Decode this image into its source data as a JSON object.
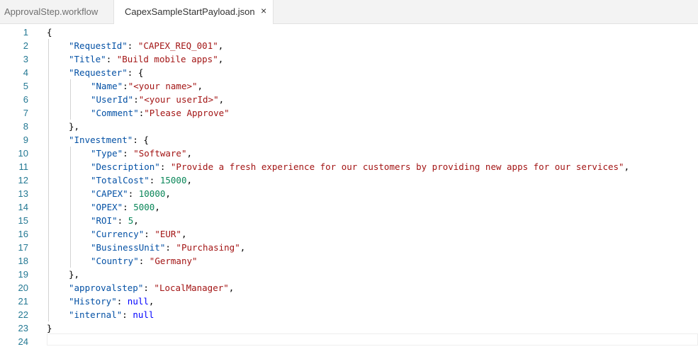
{
  "tabs": [
    {
      "label": "ApprovalStep.workflow",
      "active": false
    },
    {
      "label": "CapexSampleStartPayload.json",
      "active": true,
      "close_glyph": "×"
    }
  ],
  "colors": {
    "key": "#0451a5",
    "string": "#a31515",
    "number": "#098658",
    "literal": "#0000ff",
    "line_number": "#237893"
  },
  "lines": [
    {
      "n": "1",
      "indent": 0,
      "tokens": [
        {
          "t": "{",
          "c": "p"
        }
      ]
    },
    {
      "n": "2",
      "indent": 1,
      "tokens": [
        {
          "t": "\"RequestId\"",
          "c": "key"
        },
        {
          "t": ": ",
          "c": "p"
        },
        {
          "t": "\"CAPEX_REQ_001\"",
          "c": "str"
        },
        {
          "t": ",",
          "c": "p"
        }
      ]
    },
    {
      "n": "3",
      "indent": 1,
      "tokens": [
        {
          "t": "\"Title\"",
          "c": "key"
        },
        {
          "t": ": ",
          "c": "p"
        },
        {
          "t": "\"Build mobile apps\"",
          "c": "str"
        },
        {
          "t": ",",
          "c": "p"
        }
      ]
    },
    {
      "n": "4",
      "indent": 1,
      "tokens": [
        {
          "t": "\"Requester\"",
          "c": "key"
        },
        {
          "t": ": {",
          "c": "p"
        }
      ]
    },
    {
      "n": "5",
      "indent": 2,
      "tokens": [
        {
          "t": "\"Name\"",
          "c": "key"
        },
        {
          "t": ":",
          "c": "p"
        },
        {
          "t": "\"<your name>\"",
          "c": "str"
        },
        {
          "t": ",",
          "c": "p"
        }
      ]
    },
    {
      "n": "6",
      "indent": 2,
      "tokens": [
        {
          "t": "\"UserId\"",
          "c": "key"
        },
        {
          "t": ":",
          "c": "p"
        },
        {
          "t": "\"<your userId>\"",
          "c": "str"
        },
        {
          "t": ",",
          "c": "p"
        }
      ]
    },
    {
      "n": "7",
      "indent": 2,
      "tokens": [
        {
          "t": "\"Comment\"",
          "c": "key"
        },
        {
          "t": ":",
          "c": "p"
        },
        {
          "t": "\"Please Approve\"",
          "c": "str"
        }
      ]
    },
    {
      "n": "8",
      "indent": 1,
      "tokens": [
        {
          "t": "},",
          "c": "p"
        }
      ]
    },
    {
      "n": "9",
      "indent": 1,
      "tokens": [
        {
          "t": "\"Investment\"",
          "c": "key"
        },
        {
          "t": ": {",
          "c": "p"
        }
      ]
    },
    {
      "n": "10",
      "indent": 2,
      "tokens": [
        {
          "t": "\"Type\"",
          "c": "key"
        },
        {
          "t": ": ",
          "c": "p"
        },
        {
          "t": "\"Software\"",
          "c": "str"
        },
        {
          "t": ",",
          "c": "p"
        }
      ]
    },
    {
      "n": "11",
      "indent": 2,
      "tokens": [
        {
          "t": "\"Description\"",
          "c": "key"
        },
        {
          "t": ": ",
          "c": "p"
        },
        {
          "t": "\"Provide a fresh experience for our customers by providing new apps for our services\"",
          "c": "str"
        },
        {
          "t": ",",
          "c": "p"
        }
      ]
    },
    {
      "n": "12",
      "indent": 2,
      "tokens": [
        {
          "t": "\"TotalCost\"",
          "c": "key"
        },
        {
          "t": ": ",
          "c": "p"
        },
        {
          "t": "15000",
          "c": "num"
        },
        {
          "t": ",",
          "c": "p"
        }
      ]
    },
    {
      "n": "13",
      "indent": 2,
      "tokens": [
        {
          "t": "\"CAPEX\"",
          "c": "key"
        },
        {
          "t": ": ",
          "c": "p"
        },
        {
          "t": "10000",
          "c": "num"
        },
        {
          "t": ",",
          "c": "p"
        }
      ]
    },
    {
      "n": "14",
      "indent": 2,
      "tokens": [
        {
          "t": "\"OPEX\"",
          "c": "key"
        },
        {
          "t": ": ",
          "c": "p"
        },
        {
          "t": "5000",
          "c": "num"
        },
        {
          "t": ",",
          "c": "p"
        }
      ]
    },
    {
      "n": "15",
      "indent": 2,
      "tokens": [
        {
          "t": "\"ROI\"",
          "c": "key"
        },
        {
          "t": ": ",
          "c": "p"
        },
        {
          "t": "5",
          "c": "num"
        },
        {
          "t": ",",
          "c": "p"
        }
      ]
    },
    {
      "n": "16",
      "indent": 2,
      "tokens": [
        {
          "t": "\"Currency\"",
          "c": "key"
        },
        {
          "t": ": ",
          "c": "p"
        },
        {
          "t": "\"EUR\"",
          "c": "str"
        },
        {
          "t": ",",
          "c": "p"
        }
      ]
    },
    {
      "n": "17",
      "indent": 2,
      "tokens": [
        {
          "t": "\"BusinessUnit\"",
          "c": "key"
        },
        {
          "t": ": ",
          "c": "p"
        },
        {
          "t": "\"Purchasing\"",
          "c": "str"
        },
        {
          "t": ",",
          "c": "p"
        }
      ]
    },
    {
      "n": "18",
      "indent": 2,
      "tokens": [
        {
          "t": "\"Country\"",
          "c": "key"
        },
        {
          "t": ": ",
          "c": "p"
        },
        {
          "t": "\"Germany\"",
          "c": "str"
        }
      ]
    },
    {
      "n": "19",
      "indent": 1,
      "tokens": [
        {
          "t": "},",
          "c": "p"
        }
      ]
    },
    {
      "n": "20",
      "indent": 1,
      "tokens": [
        {
          "t": "\"approvalstep\"",
          "c": "key"
        },
        {
          "t": ": ",
          "c": "p"
        },
        {
          "t": "\"LocalManager\"",
          "c": "str"
        },
        {
          "t": ",",
          "c": "p"
        }
      ]
    },
    {
      "n": "21",
      "indent": 1,
      "tokens": [
        {
          "t": "\"History\"",
          "c": "key"
        },
        {
          "t": ": ",
          "c": "p"
        },
        {
          "t": "null",
          "c": "lit"
        },
        {
          "t": ",",
          "c": "p"
        }
      ]
    },
    {
      "n": "22",
      "indent": 1,
      "tokens": [
        {
          "t": "\"internal\"",
          "c": "key"
        },
        {
          "t": ": ",
          "c": "p"
        },
        {
          "t": "null",
          "c": "lit"
        }
      ]
    },
    {
      "n": "23",
      "indent": 0,
      "tokens": [
        {
          "t": "}",
          "c": "p"
        }
      ]
    },
    {
      "n": "24",
      "indent": 0,
      "tokens": []
    }
  ]
}
